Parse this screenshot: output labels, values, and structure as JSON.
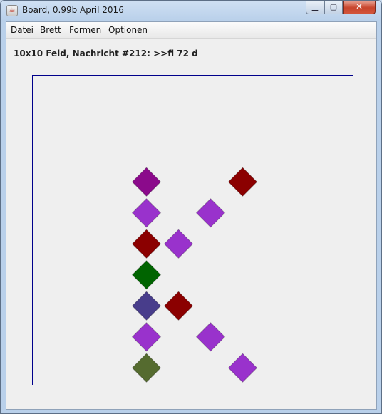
{
  "window": {
    "title": "Board, 0.99b April 2016",
    "app_icon": "java-icon",
    "controls": {
      "minimize": "▁",
      "maximize": "▢",
      "close": "✕"
    }
  },
  "menubar": {
    "items": [
      {
        "id": "datei",
        "label": "Datei"
      },
      {
        "id": "brett",
        "label": "Brett"
      },
      {
        "id": "formen",
        "label": "Formen"
      },
      {
        "id": "optionen",
        "label": "Optionen"
      }
    ]
  },
  "status": {
    "message": "10x10 Feld, Nachricht #212: >>fi 72 d"
  },
  "board": {
    "columns": 10,
    "rows": 10,
    "frame_color": "#00008b",
    "cells": [
      {
        "col": 3,
        "row": 3,
        "shape": "diamond",
        "color": "#8b0a8b"
      },
      {
        "col": 6,
        "row": 3,
        "shape": "diamond",
        "color": "#8b0000"
      },
      {
        "col": 3,
        "row": 4,
        "shape": "diamond",
        "color": "#9932cc"
      },
      {
        "col": 5,
        "row": 4,
        "shape": "diamond",
        "color": "#9932cc"
      },
      {
        "col": 3,
        "row": 5,
        "shape": "diamond",
        "color": "#8b0000"
      },
      {
        "col": 4,
        "row": 5,
        "shape": "diamond",
        "color": "#9932cc"
      },
      {
        "col": 3,
        "row": 6,
        "shape": "diamond",
        "color": "#006400"
      },
      {
        "col": 3,
        "row": 7,
        "shape": "diamond",
        "color": "#483d8b"
      },
      {
        "col": 4,
        "row": 7,
        "shape": "diamond",
        "color": "#8b0000"
      },
      {
        "col": 3,
        "row": 8,
        "shape": "diamond",
        "color": "#9932cc"
      },
      {
        "col": 5,
        "row": 8,
        "shape": "diamond",
        "color": "#9932cc"
      },
      {
        "col": 3,
        "row": 9,
        "shape": "diamond",
        "color": "#556b2f"
      },
      {
        "col": 6,
        "row": 9,
        "shape": "diamond",
        "color": "#9932cc"
      }
    ]
  }
}
